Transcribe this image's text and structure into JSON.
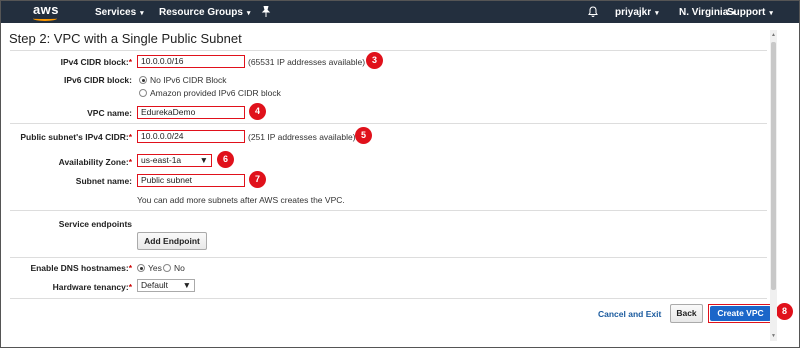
{
  "topbar": {
    "logo": "aws",
    "services": "Services",
    "resource_groups": "Resource Groups",
    "user": "priyajkr",
    "region": "N. Virginia",
    "support": "Support",
    "caret": "▾",
    "pin_icon": "pin-icon",
    "bell_icon": "bell-icon"
  },
  "page": {
    "heading": "Step 2: VPC with a Single Public Subnet"
  },
  "form": {
    "ipv4_label": "IPv4 CIDR block:",
    "ipv4_value": "10.0.0.0/16",
    "ipv4_hint": "(65531 IP addresses available)",
    "ipv6_label": "IPv6 CIDR block:",
    "ipv6_opt1": "No IPv6 CIDR Block",
    "ipv6_opt2": "Amazon provided IPv6 CIDR block",
    "vpc_name_label": "VPC name:",
    "vpc_name_value": "EdurekaDemo",
    "subnet_cidr_label": "Public subnet's IPv4 CIDR:",
    "subnet_cidr_value": "10.0.0.0/24",
    "subnet_cidr_hint": "(251 IP addresses available)",
    "az_label": "Availability Zone:",
    "az_value": "us-east-1a",
    "subnet_name_label": "Subnet name:",
    "subnet_name_value": "Public subnet",
    "subnet_note": "You can add more subnets after AWS creates the VPC.",
    "endpoints_label": "Service endpoints",
    "add_endpoint": "Add Endpoint",
    "dns_label": "Enable DNS hostnames:",
    "dns_yes": "Yes",
    "dns_no": "No",
    "tenancy_label": "Hardware tenancy:",
    "tenancy_value": "Default",
    "required_mark": "*"
  },
  "footer": {
    "cancel": "Cancel and Exit",
    "back": "Back",
    "create": "Create VPC"
  },
  "badges": [
    "3",
    "4",
    "5",
    "6",
    "7",
    "8"
  ],
  "colors": {
    "topbar": "#232f3e",
    "accent": "#e0111b",
    "primary": "#1b66c9",
    "link": "#1a5a9e"
  }
}
